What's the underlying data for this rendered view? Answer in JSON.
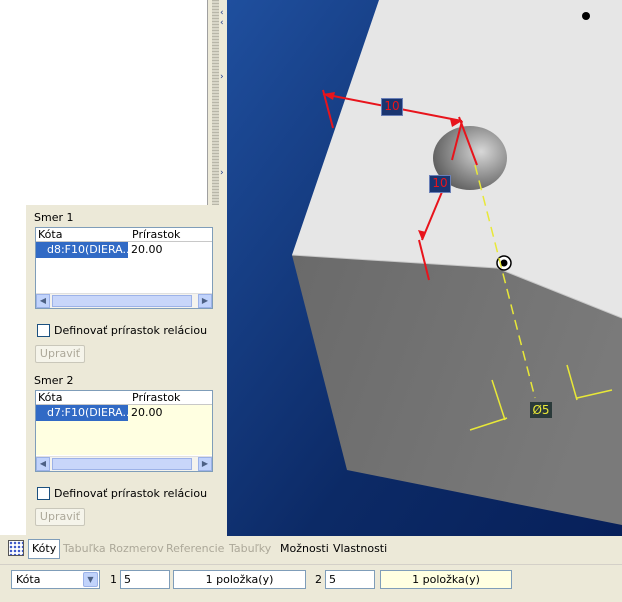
{
  "pattern_panel": {
    "dir1": {
      "title": "Smer 1",
      "col_dim": "Kóta",
      "col_inc": "Prírastok",
      "row_dim": "d8:F10(DIERA...",
      "row_inc": "20.00",
      "checkbox_label": "Definovať prírastok reláciou",
      "edit_label": "Upraviť"
    },
    "dir2": {
      "title": "Smer 2",
      "col_dim": "Kóta",
      "col_inc": "Prírastok",
      "row_dim": "d7:F10(DIERA...",
      "row_inc": "20.00",
      "checkbox_label": "Definovať prírastok reláciou",
      "edit_label": "Upraviť"
    }
  },
  "viewport": {
    "dim_h": "10",
    "dim_v": "10",
    "dim_diam": "Ø5"
  },
  "tabs": [
    {
      "label": "Kóty",
      "state": "active"
    },
    {
      "label": "Tabuľka Rozmerov",
      "state": "disabled"
    },
    {
      "label": "Referencie",
      "state": "disabled"
    },
    {
      "label": "Tabuľky",
      "state": "disabled"
    },
    {
      "label": "Možnosti",
      "state": "enabled"
    },
    {
      "label": "Vlastnosti",
      "state": "enabled"
    }
  ],
  "bottom": {
    "type_select": "Kóta",
    "dir1_label": "1",
    "dir1_count": "5",
    "dir1_items": "1 položka(y)",
    "dir2_label": "2",
    "dir2_count": "5",
    "dir2_items": "1 položka(y)"
  },
  "colors": {
    "dimension_red": "#e8141c",
    "axis_yellow": "#e8e838",
    "selection_blue": "#316ac5",
    "viewport_bg": "#0c2a66"
  },
  "icons": [
    "pattern-tab-icon",
    "combo-dropdown-icon",
    "scroll-left-icon",
    "scroll-right-icon"
  ]
}
